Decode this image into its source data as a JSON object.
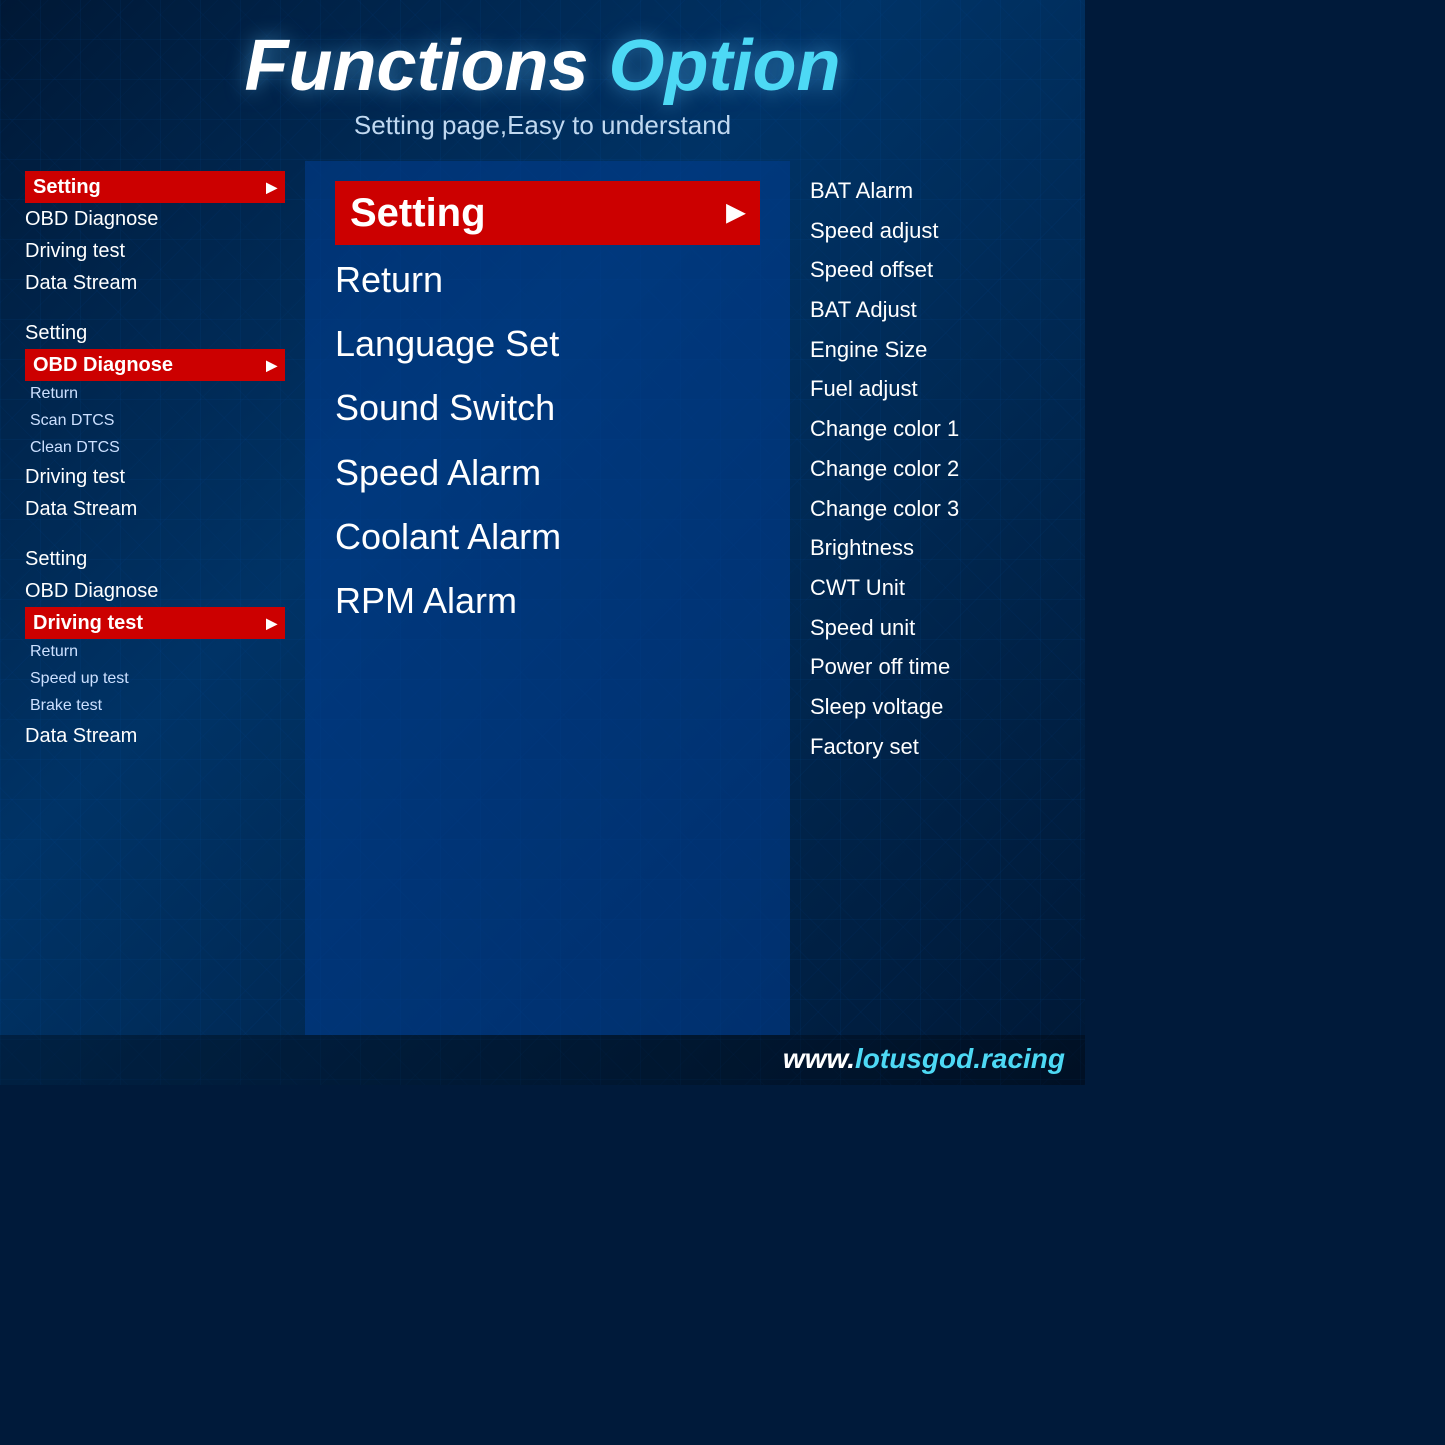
{
  "header": {
    "title_functions": "Functions",
    "title_option": "Option",
    "subtitle": "Setting page,Easy to understand"
  },
  "left_column": {
    "groups": [
      {
        "items": [
          {
            "label": "Setting",
            "highlighted": true,
            "has_arrow": true
          },
          {
            "label": "OBD Diagnose",
            "highlighted": false
          },
          {
            "label": "Driving test",
            "highlighted": false
          },
          {
            "label": "Data Stream",
            "highlighted": false
          }
        ]
      },
      {
        "items": [
          {
            "label": "Setting",
            "highlighted": false
          },
          {
            "label": "OBD Diagnose",
            "highlighted": true,
            "has_arrow": true
          },
          {
            "label": "Return",
            "sub": true
          },
          {
            "label": "Scan DTCS",
            "sub": true
          },
          {
            "label": "Clean DTCS",
            "sub": true
          },
          {
            "label": "Driving test",
            "highlighted": false
          },
          {
            "label": "Data Stream",
            "highlighted": false
          }
        ]
      },
      {
        "items": [
          {
            "label": "Setting",
            "highlighted": false
          },
          {
            "label": "OBD Diagnose",
            "highlighted": false
          },
          {
            "label": "Driving test",
            "highlighted": true,
            "has_arrow": true
          },
          {
            "label": "Return",
            "sub": true
          },
          {
            "label": "Speed up test",
            "sub": true
          },
          {
            "label": "Brake test",
            "sub": true
          },
          {
            "label": "Data Stream",
            "highlighted": false
          }
        ]
      }
    ]
  },
  "center_column": {
    "items": [
      {
        "label": "Setting",
        "highlighted": true,
        "has_arrow": true
      },
      {
        "label": "Return",
        "highlighted": false
      },
      {
        "label": "Language Set",
        "highlighted": false
      },
      {
        "label": "Sound Switch",
        "highlighted": false
      },
      {
        "label": "Speed Alarm",
        "highlighted": false
      },
      {
        "label": "Coolant Alarm",
        "highlighted": false
      },
      {
        "label": "RPM Alarm",
        "highlighted": false
      }
    ]
  },
  "right_column": {
    "items": [
      "BAT Alarm",
      "Speed adjust",
      "Speed offset",
      "BAT Adjust",
      "Engine Size",
      "Fuel adjust",
      "Change color 1",
      "Change color 2",
      "Change color 3",
      "Brightness",
      "CWT Unit",
      "Speed unit",
      "Power off time",
      "Sleep voltage",
      "Factory set"
    ]
  },
  "footer": {
    "www": "www.",
    "domain": "lotusgod.racing"
  }
}
